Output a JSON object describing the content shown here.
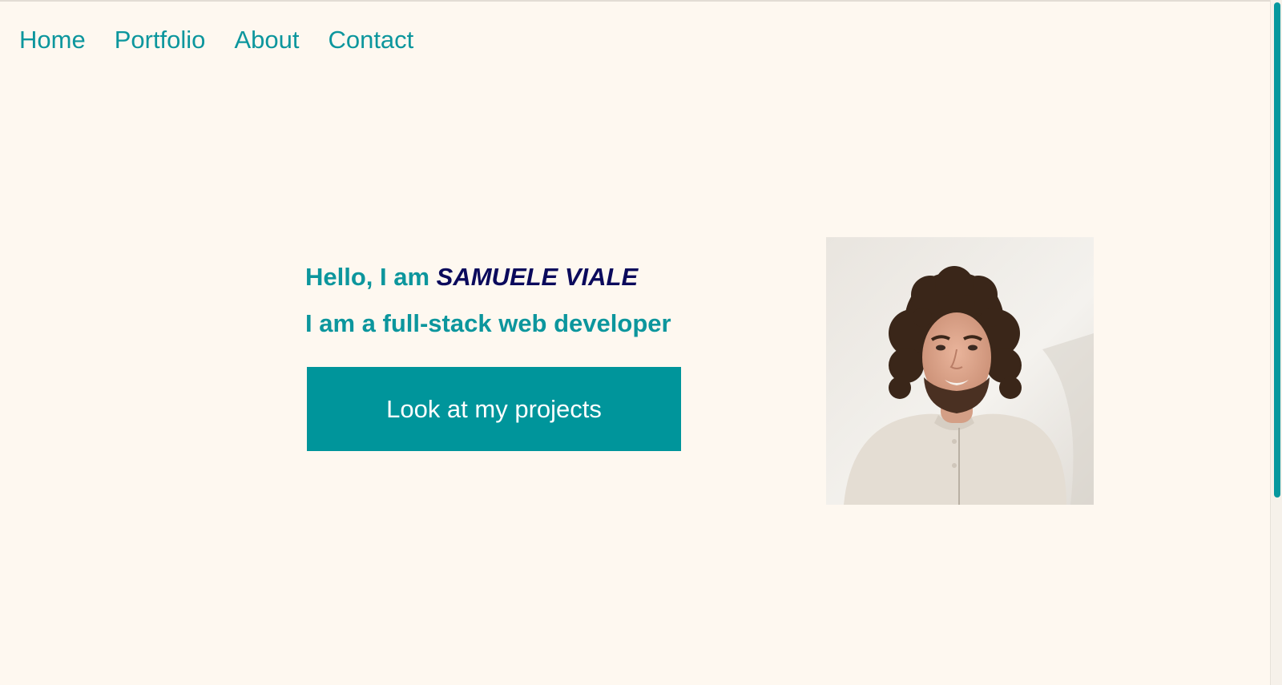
{
  "nav": {
    "items": [
      {
        "label": "Home"
      },
      {
        "label": "Portfolio"
      },
      {
        "label": "About"
      },
      {
        "label": "Contact"
      }
    ]
  },
  "hero": {
    "greeting_prefix": "Hello, I am ",
    "name": "SAMUELE VIALE",
    "role": "I am a full-stack web developer",
    "cta_label": "Look at my projects"
  },
  "portrait": {
    "description": "photo"
  },
  "scroll": {
    "position": 0
  },
  "colors": {
    "background": "#fef8f0",
    "accent": "#0c969d",
    "name": "#0b0a5c",
    "button": "#00959b",
    "button_text": "#ffffff"
  }
}
